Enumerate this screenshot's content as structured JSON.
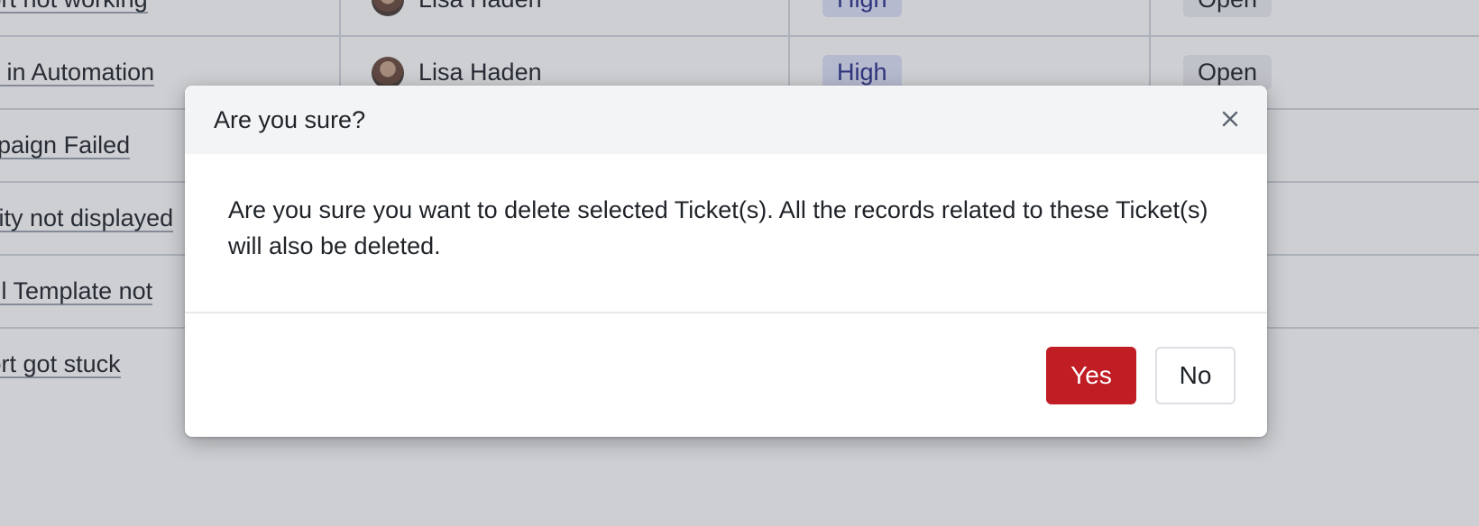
{
  "table": {
    "rows": [
      {
        "subject": "Export not working",
        "agent": "Lisa Haden",
        "priority": "High",
        "status": "Open"
      },
      {
        "subject": "Error in Automation",
        "agent": "Lisa Haden",
        "priority": "High",
        "status": "Open"
      },
      {
        "subject": "Campaign Failed",
        "agent": "",
        "priority": "",
        "status": ""
      },
      {
        "subject": "Activity not displayed",
        "agent": "",
        "priority": "",
        "status": ""
      },
      {
        "subject": "Email Template not",
        "agent": "",
        "priority": "",
        "status": ""
      },
      {
        "subject": "Export got stuck",
        "agent": "",
        "priority": "",
        "status": ""
      }
    ]
  },
  "modal": {
    "title": "Are you sure?",
    "close_icon": "close-icon",
    "message": "Are you sure you want to delete selected Ticket(s). All the records related to these Ticket(s) will also be deleted.",
    "yes_label": "Yes",
    "no_label": "No"
  },
  "colors": {
    "danger": "#c01d24",
    "priority_high_bg": "#e0e3fa",
    "priority_high_text": "#2a2e8c"
  }
}
